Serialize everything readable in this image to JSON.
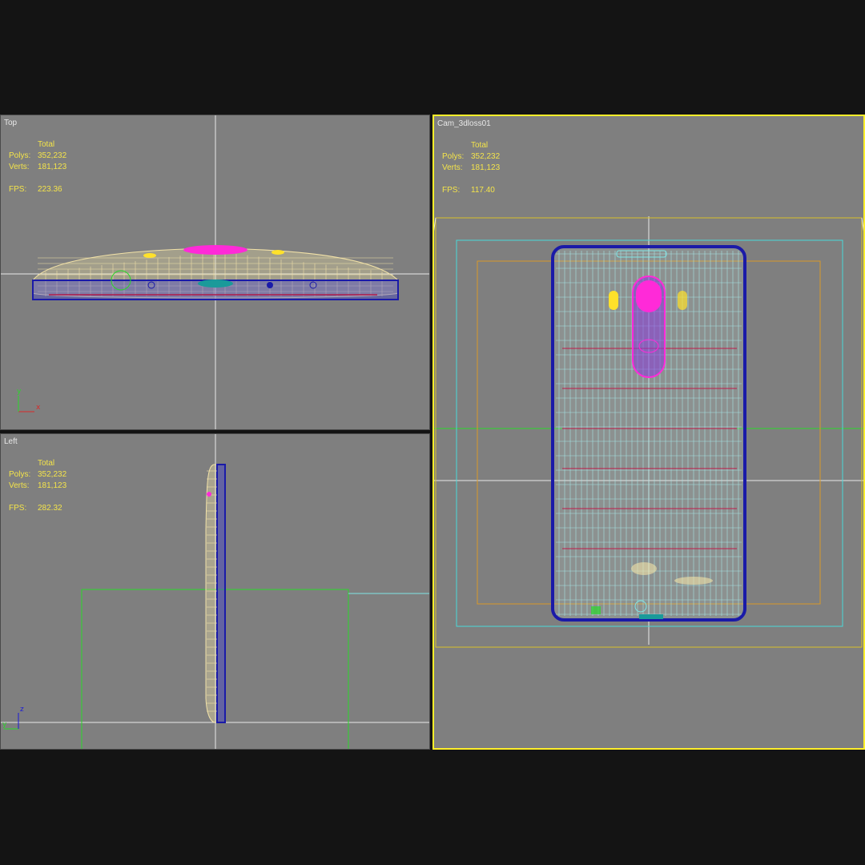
{
  "colors": {
    "background": "#141414",
    "viewport_bg": "#7f7f7f",
    "active_border": "#ffef2a",
    "stats_text": "#f4e44a",
    "wire_body": "#f2e2a8",
    "wire_edge": "#1a1aa8",
    "wire_pink": "#ff2ad8",
    "wire_cyan": "#7fe6e6",
    "grid_line": "#e8e8e8"
  },
  "viewports": {
    "top": {
      "label": "Top",
      "stats": {
        "header": "Total",
        "polys_label": "Polys:",
        "polys": "352,232",
        "verts_label": "Verts:",
        "verts": "181,123",
        "fps_label": "FPS:",
        "fps": "223.36"
      }
    },
    "left": {
      "label": "Left",
      "stats": {
        "header": "Total",
        "polys_label": "Polys:",
        "polys": "352,232",
        "verts_label": "Verts:",
        "verts": "181,123",
        "fps_label": "FPS:",
        "fps": "282.32"
      }
    },
    "camera": {
      "label": "Cam_3dloss01",
      "stats": {
        "header": "Total",
        "polys_label": "Polys:",
        "polys": "352,232",
        "verts_label": "Verts:",
        "verts": "181,123",
        "fps_label": "FPS:",
        "fps": "117.40"
      }
    }
  },
  "axis_gizmo": {
    "x": "x",
    "y": "y",
    "z": "z"
  },
  "icons": {
    "axis": "axis-gizmo-icon"
  }
}
